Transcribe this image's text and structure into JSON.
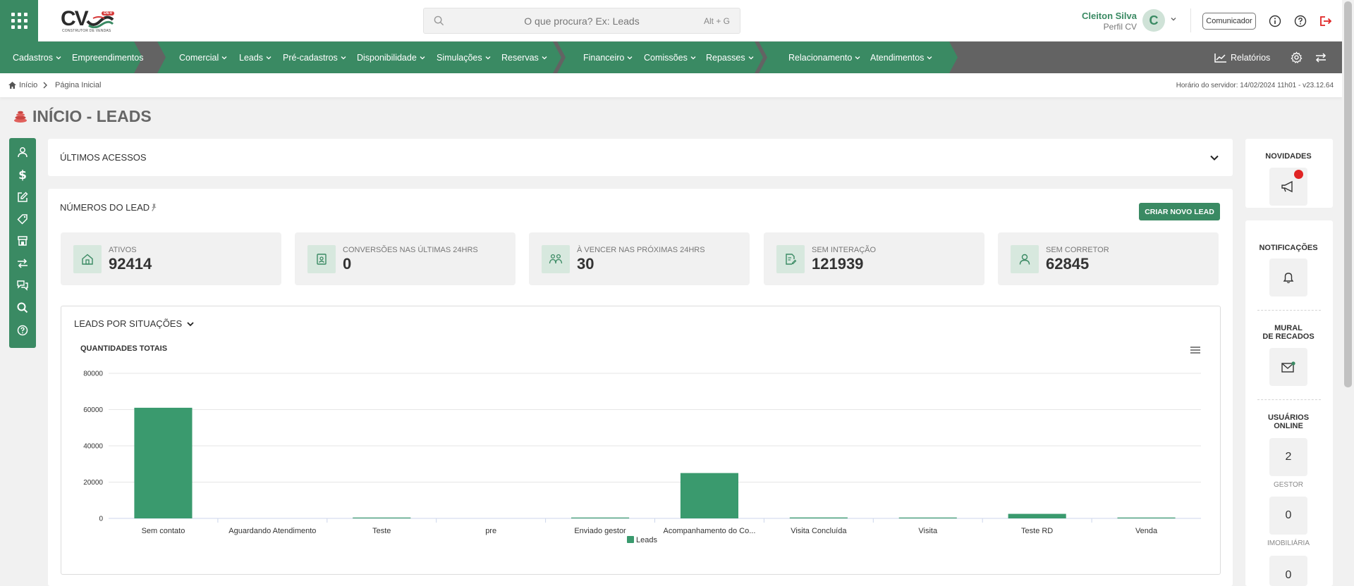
{
  "header": {
    "logo_text": "CV",
    "logo_badge": "DEV",
    "logo_sub": "CONSTRUTOR DE VENDAS",
    "search_placeholder": "O que procura? Ex: Leads",
    "search_hotkey": "Alt + G",
    "user_name": "Cleiton Silva",
    "user_profile": "Perfil CV",
    "avatar_letter": "C",
    "comunicador_label": "Comunicador"
  },
  "nav": {
    "items": [
      {
        "label": "Cadastros",
        "dropdown": true
      },
      {
        "label": "Empreendimentos",
        "dropdown": false
      },
      {
        "label": "Comercial",
        "dropdown": true
      },
      {
        "label": "Leads",
        "dropdown": true
      },
      {
        "label": "Pré-cadastros",
        "dropdown": true
      },
      {
        "label": "Disponibilidade",
        "dropdown": true
      },
      {
        "label": "Simulações",
        "dropdown": true
      },
      {
        "label": "Reservas",
        "dropdown": true
      },
      {
        "label": "Financeiro",
        "dropdown": true
      },
      {
        "label": "Comissões",
        "dropdown": true
      },
      {
        "label": "Repasses",
        "dropdown": true
      },
      {
        "label": "Relacionamento",
        "dropdown": true
      },
      {
        "label": "Atendimentos",
        "dropdown": true
      }
    ],
    "reports_label": "Relatórios"
  },
  "breadcrumb": {
    "home": "Início",
    "current": "Página Inicial",
    "server_time": "Horário do servidor: 14/02/2024 11h01 - v23.12.64"
  },
  "page": {
    "title": "INÍCIO - LEADS"
  },
  "last_access": {
    "title": "ÚLTIMOS ACESSOS"
  },
  "lead_numbers": {
    "title": "NÚMEROS DO LEAD",
    "create_button": "CRIAR NOVO LEAD",
    "cards": [
      {
        "label": "ATIVOS",
        "value": "92414",
        "icon": "house-icon"
      },
      {
        "label": "CONVERSÕES NAS ÚLTIMAS 24hrs",
        "value": "0",
        "icon": "id-badge-icon"
      },
      {
        "label": "À VENCER NAS PRÓXIMAS 24hrs",
        "value": "30",
        "icon": "people-icon"
      },
      {
        "label": "SEM INTERAÇÃO",
        "value": "121939",
        "icon": "document-edit-icon"
      },
      {
        "label": "SEM CORRETOR",
        "value": "62845",
        "icon": "user-icon"
      }
    ]
  },
  "situations": {
    "title": "LEADS POR SITUAÇÕES",
    "chart_title": "QUANTIDADES TOTAIS"
  },
  "chart_data": {
    "type": "bar",
    "title": "QUANTIDADES TOTAIS",
    "categories": [
      "Sem contato",
      "Aguardando Atendimento",
      "Teste",
      "pre",
      "Enviado gestor",
      "Acompanhamento do Co...",
      "Visita Concluída",
      "Visita",
      "Teste RD",
      "Venda"
    ],
    "series": [
      {
        "name": "Leads",
        "values": [
          61000,
          0,
          300,
          0,
          400,
          25000,
          500,
          300,
          2500,
          400
        ],
        "color": "#3a9a6e"
      }
    ],
    "yticks": [
      "0",
      "20000",
      "40000",
      "60000",
      "80000"
    ],
    "ylim": [
      0,
      80000
    ],
    "grid": true,
    "legend": "bottom"
  },
  "right_panel": {
    "news_title": "NOVIDADES",
    "notifications_title": "NOTIFICAÇÕES",
    "board_title_1": "MURAL",
    "board_title_2": "DE RECADOS",
    "online_title_1": "USUÁRIOS",
    "online_title_2": "ONLINE",
    "online_count_1": "2",
    "online_label_1": "GESTOR",
    "online_count_2": "0",
    "online_label_2": "IMOBILIÁRIA",
    "online_count_3": "0"
  },
  "colors": {
    "brand_green": "#3a8a63",
    "bar_green": "#3a9a6e",
    "nav_gray": "#636363",
    "alert_red": "#e02424"
  }
}
